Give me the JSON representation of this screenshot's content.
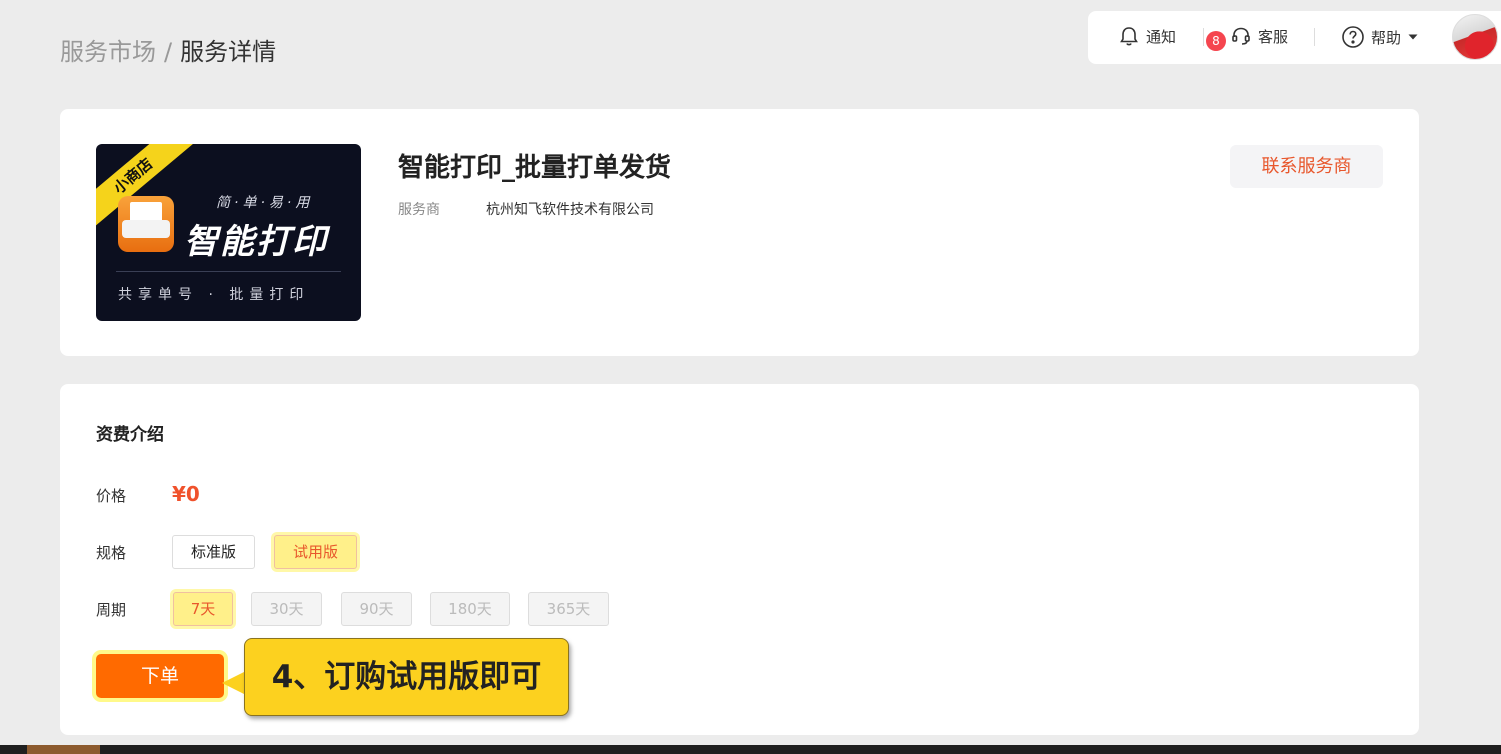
{
  "breadcrumb": {
    "root": "服务市场",
    "separator": "/",
    "current": "服务详情"
  },
  "toolbar": {
    "notify_label": "通知",
    "notify_count": "8",
    "service_label": "客服",
    "help_label": "帮助"
  },
  "product": {
    "logo": {
      "ribbon": "小商店",
      "slogan": "简·单·易·用",
      "title": "智能打印",
      "subtitle": "共享单号 · 批量打印"
    },
    "title": "智能打印_批量打单发货",
    "vendor_label": "服务商",
    "vendor_name": "杭州知飞软件技术有限公司",
    "contact_button": "联系服务商"
  },
  "pricing": {
    "section_title": "资费介绍",
    "price_label": "价格",
    "price_value": "¥0",
    "spec_label": "规格",
    "specs": [
      {
        "label": "标准版",
        "state": "normal"
      },
      {
        "label": "试用版",
        "state": "selected"
      }
    ],
    "period_label": "周期",
    "periods": [
      {
        "label": "7天",
        "state": "selected"
      },
      {
        "label": "30天",
        "state": "disabled"
      },
      {
        "label": "90天",
        "state": "disabled"
      },
      {
        "label": "180天",
        "state": "disabled"
      },
      {
        "label": "365天",
        "state": "disabled"
      }
    ],
    "order_button": "下单"
  },
  "callout": {
    "text": "4、订购试用版即可"
  },
  "colors": {
    "accent": "#ff6a00",
    "price": "#f0522c",
    "badge": "#f5454f",
    "highlight": "#fff08a",
    "callout": "#fcd11f"
  }
}
